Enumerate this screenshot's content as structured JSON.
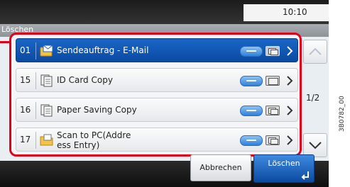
{
  "header": {
    "time": "10:10",
    "screen_title": "Löschen"
  },
  "list": {
    "rows": [
      {
        "num": "01",
        "label": "Sendeauftrag - E-Mail",
        "icon": "envelope-folder-icon",
        "mode": "duplex-icon",
        "selected": true
      },
      {
        "num": "15",
        "label": "ID Card Copy",
        "icon": "copy-documents-icon",
        "mode": "single-page-icon",
        "selected": false
      },
      {
        "num": "16",
        "label": "Paper Saving Copy",
        "icon": "copy-documents-icon",
        "mode": "duplex-icon",
        "selected": false
      },
      {
        "num": "17",
        "label": "Scan to PC(Addre\ness Entry)",
        "icon": "folder-scan-icon",
        "mode": "duplex-icon",
        "selected": false
      }
    ]
  },
  "pager": {
    "indicator": "1/2"
  },
  "footer": {
    "cancel_label": "Abbrechen",
    "delete_label": "Löschen"
  },
  "image_id": "3B0782_00",
  "colors": {
    "selected_row": "#0b4aa0",
    "highlight_frame": "#e3001b",
    "toggle": "#2f80d8"
  }
}
